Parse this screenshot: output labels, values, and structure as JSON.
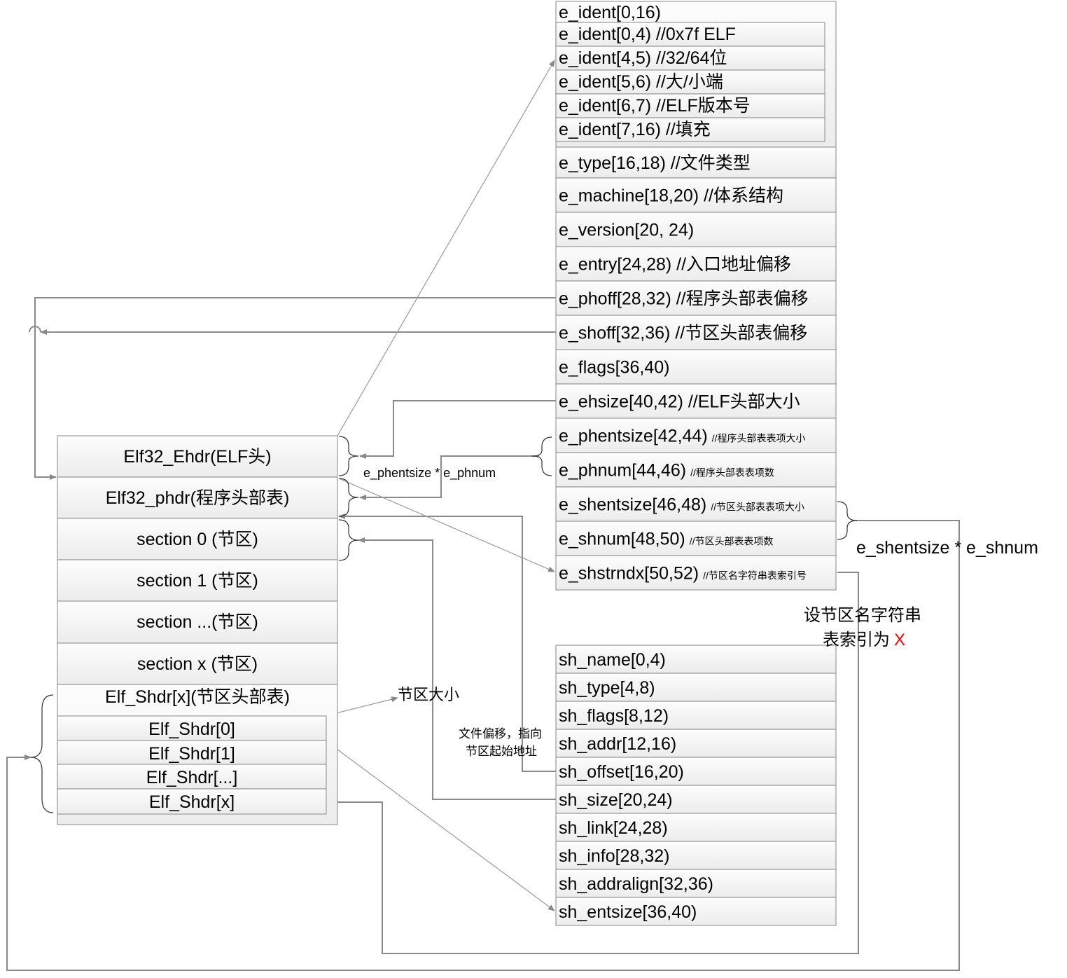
{
  "elf_header_fields": {
    "ident": "e_ident[0,16)",
    "ident_sub": [
      "e_ident[0,4) //0x7f ELF",
      "e_ident[4,5) //32/64位",
      "e_ident[5,6) //大/小端",
      "e_ident[6,7) //ELF版本号",
      "e_ident[7,16) //填充"
    ],
    "fields": [
      {
        "name": "e_type[16,18) //文件类型",
        "note": ""
      },
      {
        "name": "e_machine[18,20) //体系结构",
        "note": ""
      },
      {
        "name": "e_version[20, 24)",
        "note": ""
      },
      {
        "name": "e_entry[24,28) //入口地址偏移",
        "note": ""
      },
      {
        "name": "e_phoff[28,32) //程序头部表偏移",
        "note": ""
      },
      {
        "name": "e_shoff[32,36) //节区头部表偏移",
        "note": ""
      },
      {
        "name": "e_flags[36,40)",
        "note": ""
      },
      {
        "name": "e_ehsize[40,42) //ELF头部大小",
        "note": ""
      },
      {
        "name": "e_phentsize[42,44)",
        "note": "//程序头部表表项大小"
      },
      {
        "name": "e_phnum[44,46)",
        "note": "//程序头部表表项数"
      },
      {
        "name": "e_shentsize[46,48)",
        "note": "//节区头部表表项大小"
      },
      {
        "name": "e_shnum[48,50)",
        "note": "//节区头部表表项数"
      },
      {
        "name": "e_shstrndx[50,52)",
        "note": "//节区名字符串表索引号"
      }
    ]
  },
  "elf_file_layout": {
    "blocks": [
      "Elf32_Ehdr(ELF头)",
      "Elf32_phdr(程序头部表)",
      "section 0 (节区)",
      "section 1 (节区)",
      "section ...(节区)",
      "section x (节区)",
      "Elf_Shdr[x](节区头部表)"
    ],
    "shdr_entries": [
      "Elf_Shdr[0]",
      "Elf_Shdr[1]",
      "Elf_Shdr[...]",
      "Elf_Shdr[x]"
    ]
  },
  "section_header_fields": [
    "sh_name[0,4)",
    "sh_type[4,8)",
    "sh_flags[8,12)",
    "sh_addr[12,16)",
    "sh_offset[16,20)",
    "sh_size[20,24)",
    "sh_link[24,28)",
    "sh_info[28,32)",
    "sh_addralign[32,36)",
    "sh_entsize[36,40)"
  ],
  "annotations": {
    "ph_size": "e_phentsize * e_phnum",
    "sh_size": "e_shentsize * e_shnum",
    "shstrndx_line1": "设节区名字符串",
    "shstrndx_line2": "表索引为",
    "shstrndx_x": "X",
    "section_size": "节区大小",
    "offset_line1": "文件偏移，指向",
    "offset_line2": "节区起始地址"
  },
  "colors": {
    "highlight": "#ff0000",
    "line": "#8a8a8a"
  }
}
